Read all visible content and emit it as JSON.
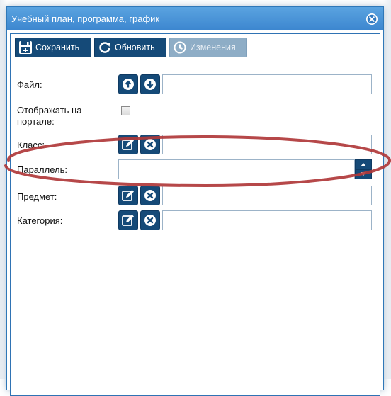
{
  "dialog": {
    "title": "Учебный план, программа, график"
  },
  "toolbar": {
    "save_label": "Сохранить",
    "refresh_label": "Обновить",
    "changes_label": "Изменения"
  },
  "form": {
    "file": {
      "label": "Файл:",
      "value": ""
    },
    "show_on_portal": {
      "label_line1": "Отображать на",
      "label_line2": "портале:",
      "checked": false
    },
    "class": {
      "label": "Класс:",
      "value": ""
    },
    "parallel": {
      "label": "Параллель:",
      "value": ""
    },
    "subject": {
      "label": "Предмет:",
      "value": ""
    },
    "category": {
      "label": "Категория:",
      "value": ""
    }
  },
  "colors": {
    "titlebar": "#3c86cf",
    "button": "#154a78",
    "button_disabled": "#8eadc6",
    "annotation": "#b0383a"
  }
}
